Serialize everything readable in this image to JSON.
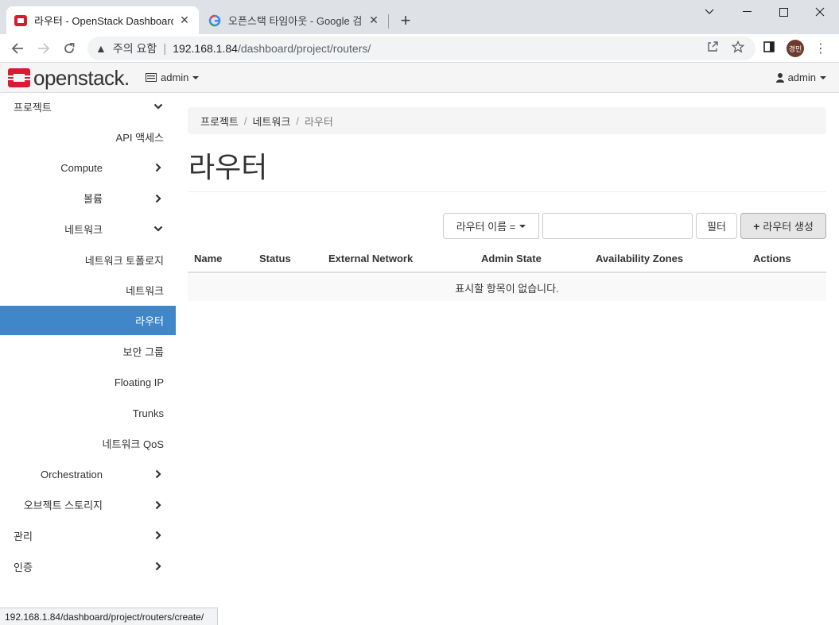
{
  "browser": {
    "tabs": [
      {
        "title": "라우터 - OpenStack Dashboard",
        "active": true
      },
      {
        "title": "오픈스택 타임아웃 - Google 검색",
        "active": false
      }
    ],
    "security_label": "주의 요함",
    "url_host": "192.168.1.84",
    "url_path": "/dashboard/project/routers/",
    "profile_initials": "경민",
    "status_url": "192.168.1.84/dashboard/project/routers/create/"
  },
  "header": {
    "brand": "openstack.",
    "project": "admin",
    "user": "admin"
  },
  "sidebar": {
    "items": [
      {
        "label": "프로젝트",
        "level": 0,
        "chevron": "down"
      },
      {
        "label": "API 액세스",
        "level": 2,
        "chevron": "none"
      },
      {
        "label": "Compute",
        "level": 1,
        "chevron": "right"
      },
      {
        "label": "볼륨",
        "level": 1,
        "chevron": "right"
      },
      {
        "label": "네트워크",
        "level": 1,
        "chevron": "down"
      },
      {
        "label": "네트워크 토폴로지",
        "level": 2,
        "chevron": "none"
      },
      {
        "label": "네트워크",
        "level": 2,
        "chevron": "none"
      },
      {
        "label": "라우터",
        "level": 2,
        "chevron": "none",
        "active": true
      },
      {
        "label": "보안 그룹",
        "level": 2,
        "chevron": "none"
      },
      {
        "label": "Floating IP",
        "level": 2,
        "chevron": "none"
      },
      {
        "label": "Trunks",
        "level": 2,
        "chevron": "none"
      },
      {
        "label": "네트워크 QoS",
        "level": 2,
        "chevron": "none"
      },
      {
        "label": "Orchestration",
        "level": 1,
        "chevron": "right"
      },
      {
        "label": "오브젝트 스토리지",
        "level": 1,
        "chevron": "right"
      },
      {
        "label": "관리",
        "level": 0,
        "chevron": "right"
      },
      {
        "label": "인증",
        "level": 0,
        "chevron": "right"
      }
    ]
  },
  "breadcrumb": [
    "프로젝트",
    "네트워크",
    "라우터"
  ],
  "page_title": "라우터",
  "filter": {
    "field_label": "라우터 이름 =",
    "input_value": "",
    "filter_button": "필터",
    "create_button": "라우터 생성"
  },
  "table": {
    "columns": [
      "Name",
      "Status",
      "External Network",
      "Admin State",
      "Availability Zones",
      "Actions"
    ],
    "empty_message": "표시할 항목이 없습니다."
  },
  "colors": {
    "active_nav": "#3f87c8",
    "brand_red": "#da1a32"
  }
}
